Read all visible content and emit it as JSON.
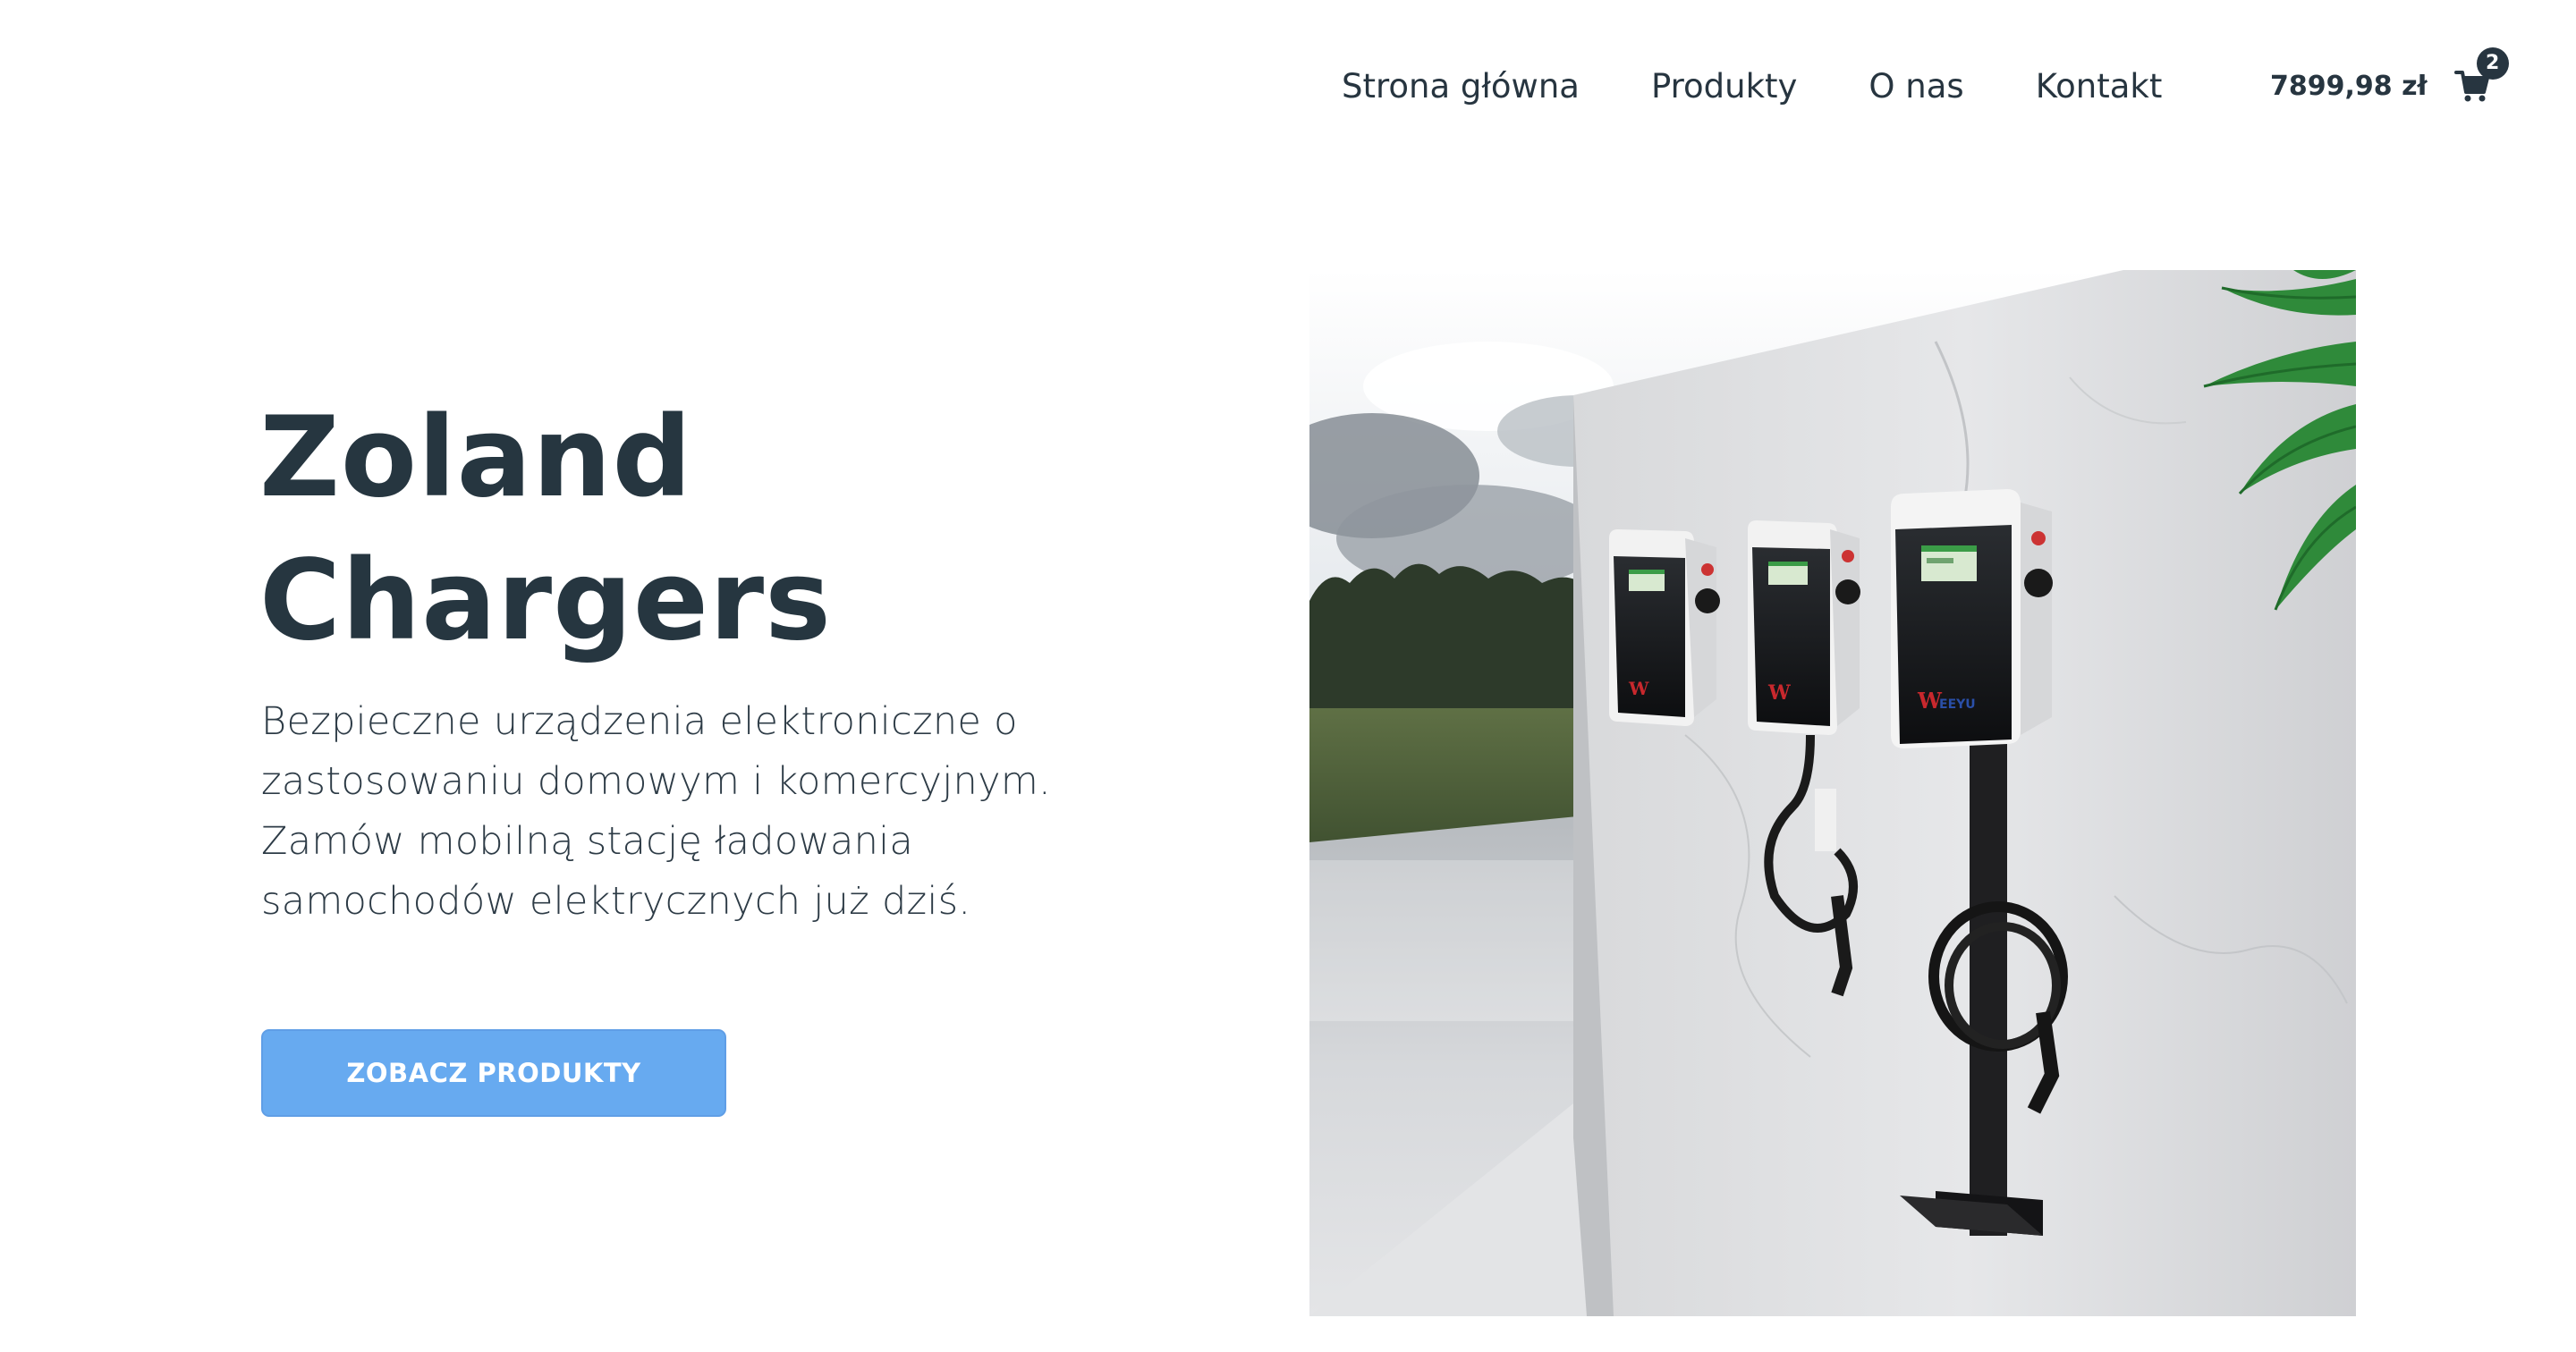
{
  "nav": {
    "items": [
      {
        "label": "Strona główna"
      },
      {
        "label": "Produkty"
      },
      {
        "label": "O nas"
      },
      {
        "label": "Kontakt"
      }
    ]
  },
  "cart": {
    "total": "7899,98 zł",
    "count": "2",
    "icon": "shopping-cart-icon"
  },
  "hero": {
    "title_line1": "Zoland",
    "title_line2": "Chargers",
    "description": "Bezpieczne urządzenia elektroniczne o zastosowaniu domowym i komercyjnym. Zamów mobilną stację ładowania samochodów elektrycznych już dziś.",
    "button_label": "ZOBACZ PRODUKTY",
    "charger_brand": "WEEYU"
  },
  "colors": {
    "heading": "#263640",
    "button": "#67aaf0",
    "badge": "#273540"
  }
}
